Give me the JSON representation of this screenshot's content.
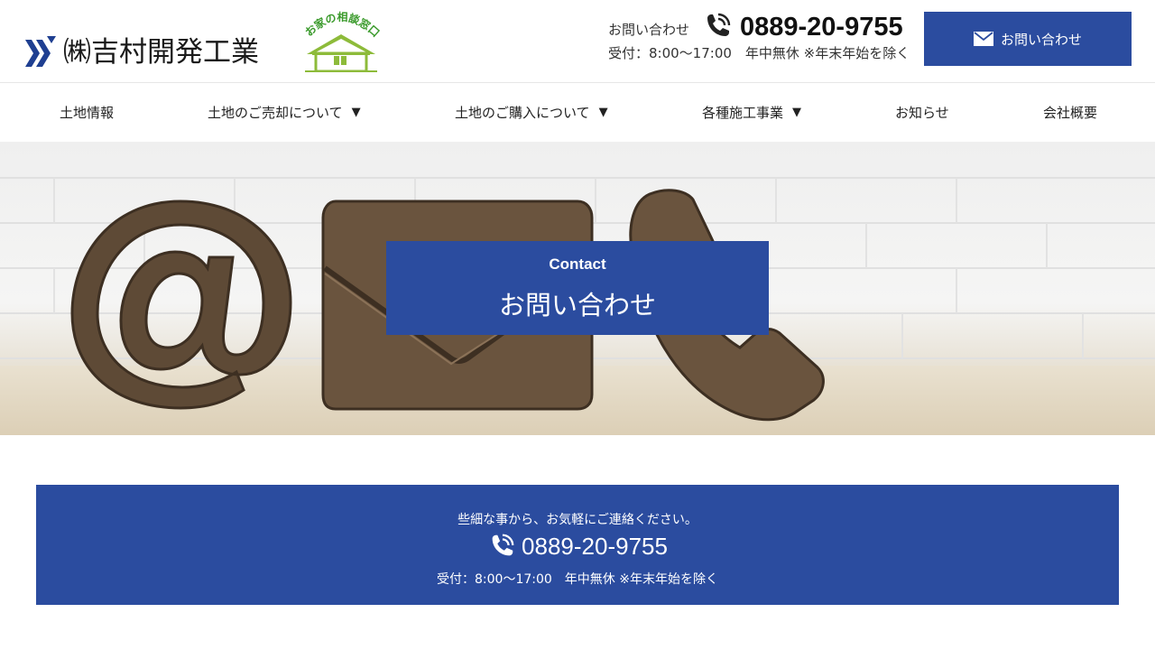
{
  "header": {
    "company_name": "㈱吉村開発工業",
    "badge_text": "お家の相談窓口",
    "contact_label": "お問い合わせ",
    "phone": "0889-20-9755",
    "hours": "受付：8:00～17:00　年中無休 ※年末年始を除く",
    "contact_button_label": "お問い合わせ",
    "icons": {
      "phone": "phone-icon",
      "mail": "mail-icon"
    }
  },
  "nav": {
    "items": [
      {
        "label": "土地情報",
        "has_dropdown": false
      },
      {
        "label": "土地のご売却について",
        "has_dropdown": true
      },
      {
        "label": "土地のご購入について",
        "has_dropdown": true
      },
      {
        "label": "各種施工事業",
        "has_dropdown": true
      },
      {
        "label": "お知らせ",
        "has_dropdown": false
      },
      {
        "label": "会社概要",
        "has_dropdown": false
      }
    ],
    "caret": "▼"
  },
  "hero": {
    "subtitle": "Contact",
    "title": "お問い合わせ"
  },
  "banner": {
    "lead": "些細な事から、お気軽にご連絡ください。",
    "phone": "0889-20-9755",
    "hours": "受付：8:00〜17:00　年中無休 ※年末年始を除く"
  },
  "colors": {
    "brand_blue": "#2b4c9f",
    "badge_green": "#8dbb3a"
  }
}
